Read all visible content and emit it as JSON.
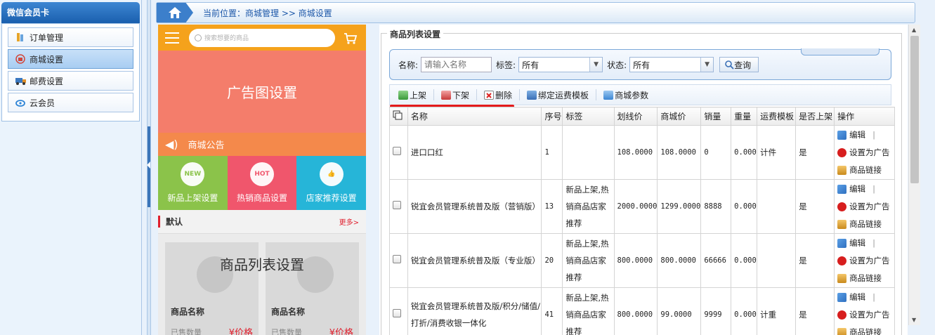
{
  "sidebar": {
    "title": "微信会员卡",
    "items": [
      {
        "label": "订单管理",
        "icon": "order-icon"
      },
      {
        "label": "商城设置",
        "icon": "mall-icon",
        "active": true
      },
      {
        "label": "邮费设置",
        "icon": "truck-icon"
      },
      {
        "label": "云会员",
        "icon": "cloud-icon"
      }
    ]
  },
  "breadcrumb": {
    "text": "当前位置：商城管理 >> 商城设置"
  },
  "mobile": {
    "search_placeholder": "搜索想要的商品",
    "ad_label": "广告图设置",
    "notice_label": "商城公告",
    "categories": [
      {
        "label": "新品上架设置",
        "badge": "NEW",
        "color": "#8bc34a"
      },
      {
        "label": "热销商品设置",
        "badge": "HOT",
        "color": "#f0566c"
      },
      {
        "label": "店家推荐设置",
        "badge": "👍",
        "color": "#26b5d8"
      }
    ],
    "default_label": "默认",
    "more_label": "更多>",
    "goods_overlay": "商品列表设置",
    "goods": [
      {
        "name": "商品名称",
        "sale": "已售数量",
        "price": "¥价格"
      },
      {
        "name": "商品名称",
        "sale": "已售数量",
        "price": "¥价格"
      }
    ]
  },
  "panel": {
    "legend": "商品列表设置",
    "search": {
      "name_label": "名称:",
      "name_placeholder": "请输入名称",
      "tag_label": "标签:",
      "tag_value": "所有",
      "status_label": "状态:",
      "status_value": "所有",
      "query_label": "查询"
    },
    "toolbar": {
      "on_shelf": "上架",
      "off_shelf": "下架",
      "delete": "删除",
      "bind_template": "绑定运费模板",
      "mall_params": "商城参数"
    },
    "table": {
      "headers": [
        "名称",
        "序号",
        "标签",
        "划线价",
        "商城价",
        "销量",
        "重量",
        "运费模板",
        "是否上架",
        "操作"
      ],
      "op_labels": {
        "edit": "编辑",
        "ad": "设置为广告",
        "link": "商品链接"
      },
      "rows": [
        {
          "name": "进口口红",
          "seq": "1",
          "tag": "",
          "list_price": "108.0000",
          "mall_price": "108.0000",
          "sales": "0",
          "weight": "0.000",
          "template": "计件",
          "on_shelf": "是"
        },
        {
          "name": "锐宜会员管理系统普及版（营销版）",
          "seq": "13",
          "tag": "新品上架,热销商品店家推荐",
          "list_price": "2000.0000",
          "mall_price": "1299.0000",
          "sales": "8888",
          "weight": "0.000",
          "template": "",
          "on_shelf": "是"
        },
        {
          "name": "锐宜会员管理系统普及版（专业版）",
          "seq": "20",
          "tag": "新品上架,热销商品店家推荐",
          "list_price": "800.0000",
          "mall_price": "800.0000",
          "sales": "66666",
          "weight": "0.000",
          "template": "",
          "on_shelf": "是"
        },
        {
          "name": "锐宜会员管理系统普及版/积分/储值/打折/消费收银一体化",
          "seq": "41",
          "tag": "新品上架,热销商品店家推荐",
          "list_price": "800.0000",
          "mall_price": "99.0000",
          "sales": "9999",
          "weight": "0.000",
          "template": "计重",
          "on_shelf": "是"
        }
      ]
    }
  },
  "colors": {
    "accent": "#1a5fae",
    "mobile_top": "#f5a21c",
    "mobile_ad": "#f47d6b",
    "mobile_notice": "#f4894b",
    "highlight_line": "#e41b1b"
  }
}
